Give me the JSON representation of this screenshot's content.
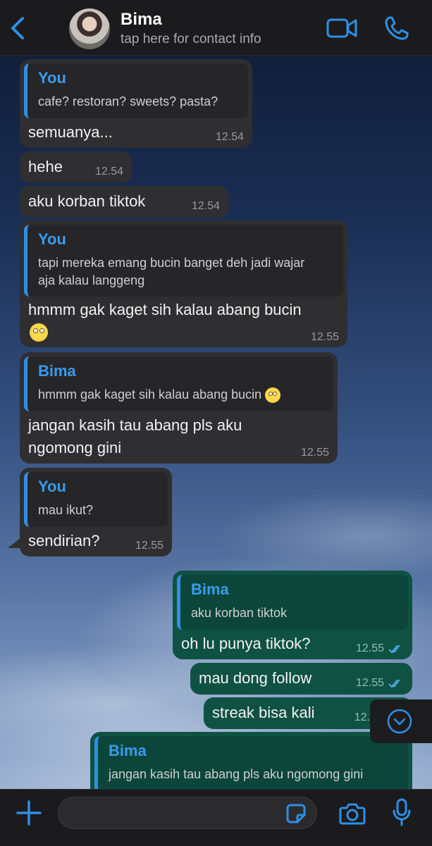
{
  "header": {
    "back_label": "",
    "contact_name": "Bima",
    "contact_subtitle": "tap here for contact info"
  },
  "messages": [
    {
      "direction": "in",
      "quote_author": "You",
      "quote_text": "cafe? restoran? sweets? pasta?",
      "text": "semuanya...",
      "time": "12.54"
    },
    {
      "direction": "in",
      "text": "hehe",
      "time": "12.54"
    },
    {
      "direction": "in",
      "text": "aku korban tiktok",
      "time": "12.54"
    },
    {
      "direction": "in",
      "quote_author": "You",
      "quote_text": "tapi mereka emang bucin banget deh jadi wajar aja kalau langgeng",
      "text": "hmmm gak kaget sih kalau abang bucin",
      "emoji": "face-with-rolling-eyes",
      "time": "12.55"
    },
    {
      "direction": "in",
      "quote_author": "Bima",
      "quote_text": "hmmm gak kaget sih kalau abang bucin",
      "quote_emoji": "face-with-rolling-eyes",
      "text": "jangan kasih tau abang pls aku ngomong gini",
      "time": "12.55"
    },
    {
      "direction": "in",
      "quote_author": "You",
      "quote_text": "mau ikut?",
      "text": "sendirian?",
      "time": "12.55"
    },
    {
      "direction": "out",
      "quote_author": "Bima",
      "quote_text": "aku korban tiktok",
      "text": "oh lu punya tiktok?",
      "time": "12.55",
      "status": "read"
    },
    {
      "direction": "out",
      "text": "mau dong follow",
      "time": "12.55",
      "status": "read"
    },
    {
      "direction": "out",
      "text": "streak bisa kali",
      "time": "12."
    },
    {
      "direction": "out",
      "quote_author": "Bima",
      "quote_text": "jangan kasih tau abang pls aku ngomong gini"
    }
  ],
  "composer": {
    "value": "",
    "placeholder": ""
  },
  "icons": {
    "back": "chevron-left-icon",
    "video": "video-camera-icon",
    "call": "phone-icon",
    "scroll": "chevron-down-circle-icon",
    "attach": "plus-icon",
    "sticker": "sticker-icon",
    "camera": "camera-icon",
    "mic": "microphone-icon"
  },
  "colors": {
    "accent": "#2f8fe6",
    "incoming_bubble": "#2f2f31",
    "outgoing_bubble": "#0f5244",
    "read_ticks": "#53b8f5"
  }
}
